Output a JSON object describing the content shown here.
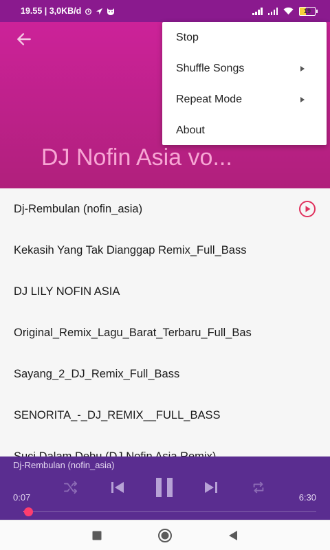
{
  "status_bar": {
    "time_info": "19.55 | 3,0KB/d",
    "battery_level": "19",
    "icons": [
      "alarm-icon",
      "location-icon",
      "cat-icon",
      "signal-icon",
      "wifi-icon",
      "battery-icon"
    ]
  },
  "header": {
    "album_title": "DJ Nofin Asia vo..."
  },
  "menu": {
    "items": [
      {
        "label": "Stop",
        "has_submenu": false
      },
      {
        "label": "Shuffle Songs",
        "has_submenu": true
      },
      {
        "label": "Repeat Mode",
        "has_submenu": true
      },
      {
        "label": "About",
        "has_submenu": false
      }
    ]
  },
  "songs": [
    {
      "title": "Dj-Rembulan (nofin_asia)",
      "playing": true
    },
    {
      "title": "Kekasih Yang Tak Dianggap Remix_Full_Bass"
    },
    {
      "title": "DJ LILY NOFIN ASIA"
    },
    {
      "title": "Original_Remix_Lagu_Barat_Terbaru_Full_Bas"
    },
    {
      "title": "Sayang_2_DJ_Remix_Full_Bass"
    },
    {
      "title": "SENORITA_-_DJ_REMIX__FULL_BASS"
    },
    {
      "title": "Suci Dalam Debu (DJ Nofin Asia Remix)"
    }
  ],
  "player": {
    "now_playing": "Dj-Rembulan (nofin_asia)",
    "elapsed": "0:07",
    "total": "6:30",
    "progress_fraction": 0.018
  },
  "colors": {
    "status_bar": "#8a1a8e",
    "header": "#c2218e",
    "player": "#5a2d90",
    "accent": "#e0325d",
    "seek_thumb": "#ff3d6e"
  }
}
